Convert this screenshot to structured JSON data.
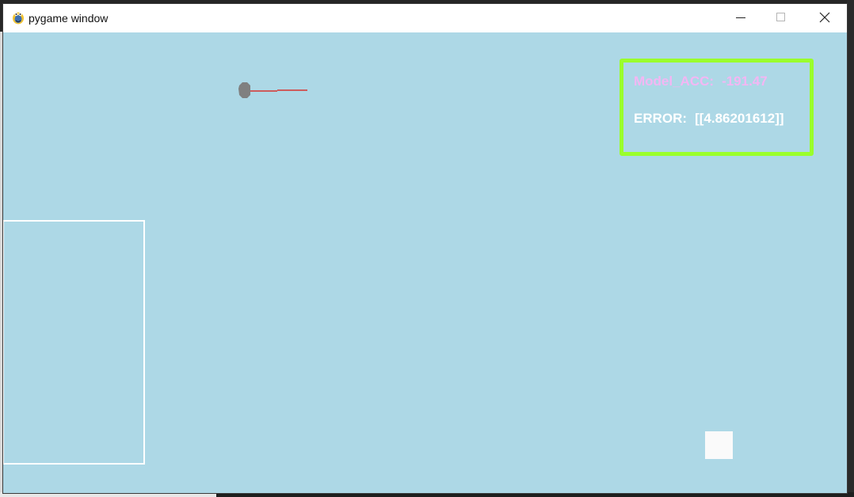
{
  "window": {
    "title": "pygame window"
  },
  "hud": {
    "accuracy_label": "Model_ACC:",
    "accuracy_value": "-191.47",
    "error_label": "ERROR:",
    "error_value": "[[4.86201612]]"
  },
  "colors": {
    "canvas_background": "#add8e6",
    "hud_border": "#9aff2c",
    "accuracy_text": "#f3b6f3",
    "error_text": "#ffffff",
    "agent_body": "#808080",
    "agent_direction": "#cd5c5c",
    "goal_outline": "#ffffff",
    "target_fill": "#fafafa"
  },
  "icons": {
    "app": "pygame-snake-icon",
    "minimize": "minimize-icon",
    "maximize": "maximize-icon",
    "close": "close-icon"
  }
}
